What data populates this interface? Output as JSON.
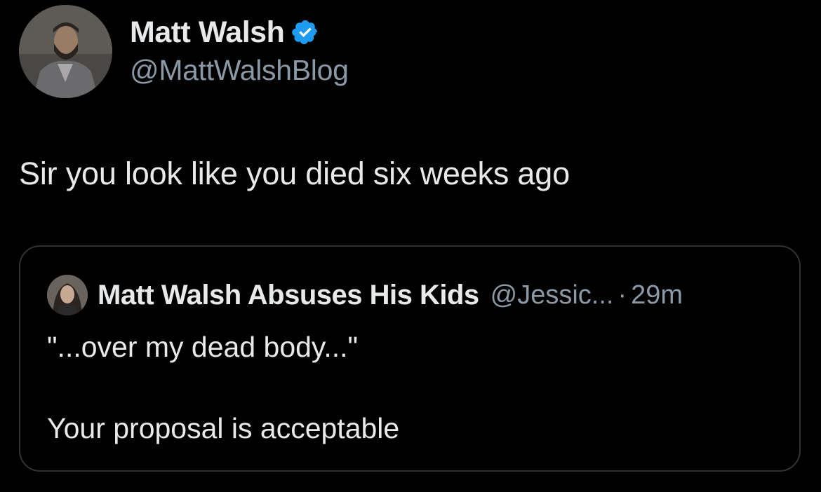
{
  "tweet": {
    "author_name": "Matt Walsh",
    "author_handle": "@MattWalshBlog",
    "verified": true,
    "text": "Sir you look like you died six weeks ago"
  },
  "quote": {
    "author_name": "Matt Walsh Absuses His Kids",
    "author_handle": "@Jessic...",
    "separator": "·",
    "time": "29m",
    "lines": [
      "\"...over my dead body...\"",
      "Your proposal is acceptable"
    ]
  },
  "colors": {
    "background": "#000000",
    "text_primary": "#e7e9ea",
    "text_secondary": "#8b98a5",
    "border": "#2f3336",
    "verified_badge": "#1d9bf0"
  }
}
